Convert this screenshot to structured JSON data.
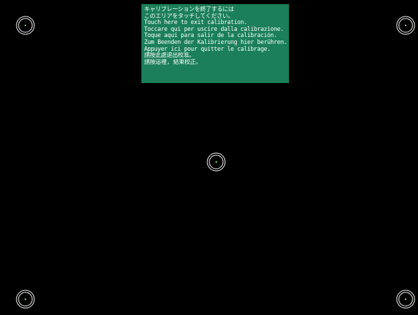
{
  "exit_panel": {
    "lines": [
      "キャリブレーションを終了するには",
      "このエリアをタッチしてください。",
      "Touch here to exit calibration.",
      "Toccare qui per uscire dalla calibrazione.",
      "Toque aquí para salir de la calibración.",
      "Zum Beenden der Kalibrierung hier berühren.",
      "Appuyer ici pour quitter le calibrage.",
      "請按此處退出校准。",
      "請按這裡, 結束校正。"
    ],
    "background_color": "#1a7f5a",
    "text_color": "#ffffff"
  },
  "targets": {
    "ring_color": "#ffffff",
    "dot_color": "#4cff6a",
    "items": [
      "top-left",
      "top-right",
      "center",
      "bottom-left",
      "bottom-right"
    ],
    "icon": "crosshair-ring-icon"
  },
  "screen": {
    "background_color": "#000000"
  }
}
